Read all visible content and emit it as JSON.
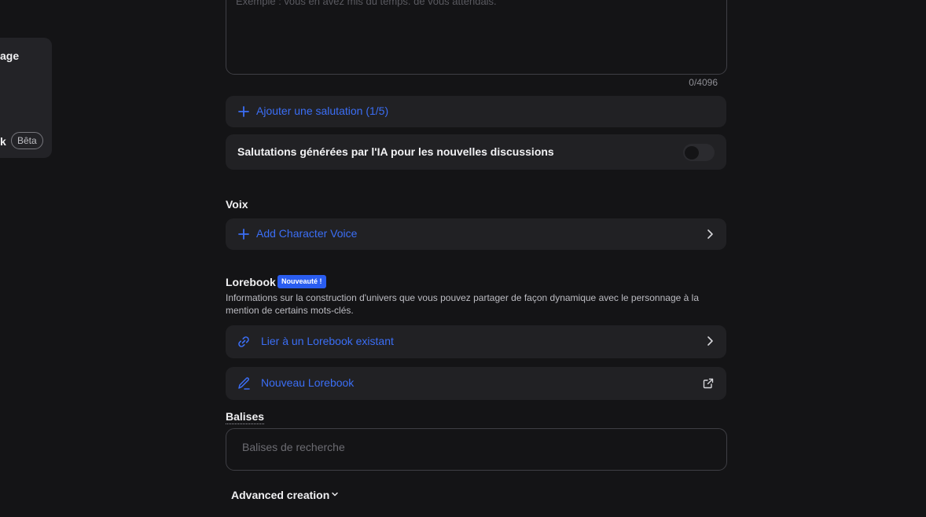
{
  "side_panel": {
    "label_top": "age",
    "label_bottom": "k",
    "beta_badge": "Bêta"
  },
  "greeting": {
    "textarea_placeholder": "Exemple : vous en avez mis du temps. de vous attendais.",
    "counter": "0/4096",
    "add_greeting_label": "Ajouter une salutation (1/5)",
    "ai_greetings_label": "Salutations générées par l'IA pour les nouvelles discussions",
    "ai_greetings_enabled": false
  },
  "voice": {
    "title": "Voix",
    "add_voice_label": "Add Character Voice"
  },
  "lorebook": {
    "title": "Lorebook",
    "new_badge": "Nouveauté !",
    "description": "Informations sur la construction d'univers que vous pouvez partager de façon dynamique avec le personnage à la mention de certains mots-clés.",
    "link_existing_label": "Lier à un Lorebook existant",
    "new_lorebook_label": "Nouveau Lorebook"
  },
  "tags": {
    "title": "Balises",
    "search_placeholder": "Balises de recherche"
  },
  "advanced": {
    "label": "Advanced creation"
  },
  "icons": {
    "plus": "plus-icon",
    "chevron": "chevron-right-icon",
    "link": "link-icon",
    "pencil": "pencil-icon",
    "external": "external-link-icon",
    "caret": "chevron-down-icon"
  },
  "colors": {
    "accent": "#3b6ef5",
    "badge": "#2a5df0",
    "background": "#141416",
    "card": "#212124"
  }
}
